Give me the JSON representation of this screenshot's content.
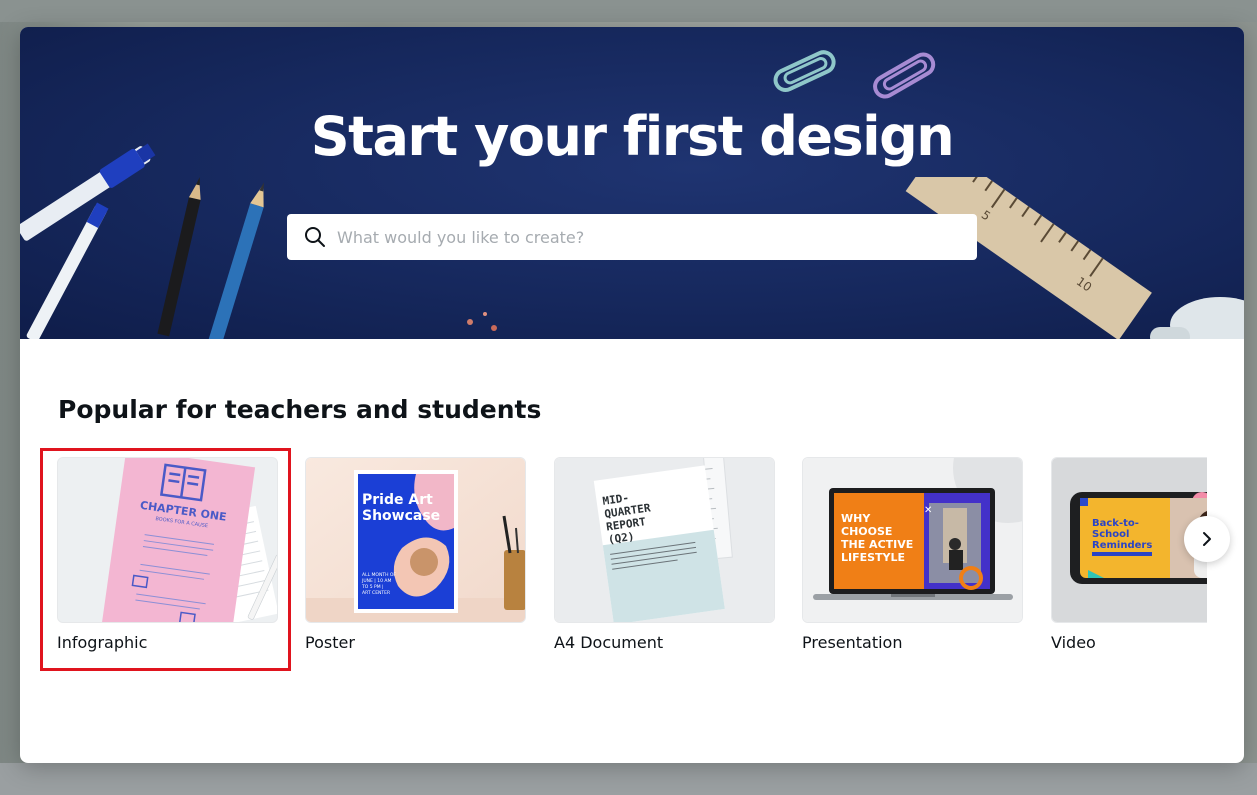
{
  "hero": {
    "title": "Start your first design",
    "search_placeholder": "What would you like to create?",
    "search_icon": "search-icon",
    "ruler_numbers": [
      "5",
      "10"
    ]
  },
  "section": {
    "title": "Popular for teachers and students"
  },
  "cards": [
    {
      "label": "Infographic",
      "thumb_text": [
        "CHAPTER ONE",
        "BOOKS FOR A CAUSE"
      ]
    },
    {
      "label": "Poster",
      "thumb_text": [
        "Pride Art Showcase",
        "ALL MONTH OF JUNE | 10 AM TO 5 PM | ART CENTER"
      ]
    },
    {
      "label": "A4 Document",
      "thumb_text": [
        "MID-QUARTER REPORT (Q2)"
      ]
    },
    {
      "label": "Presentation",
      "thumb_text": [
        "WHY CHOOSE THE ACTIVE LIFESTYLE"
      ]
    },
    {
      "label": "Video",
      "thumb_text": [
        "Back-to-School Reminders"
      ]
    }
  ],
  "carousel_next_icon": "chevron-right-icon",
  "colors": {
    "hero_bg": "#16285d",
    "highlight": "#e0141e",
    "text": "#0e1318"
  }
}
